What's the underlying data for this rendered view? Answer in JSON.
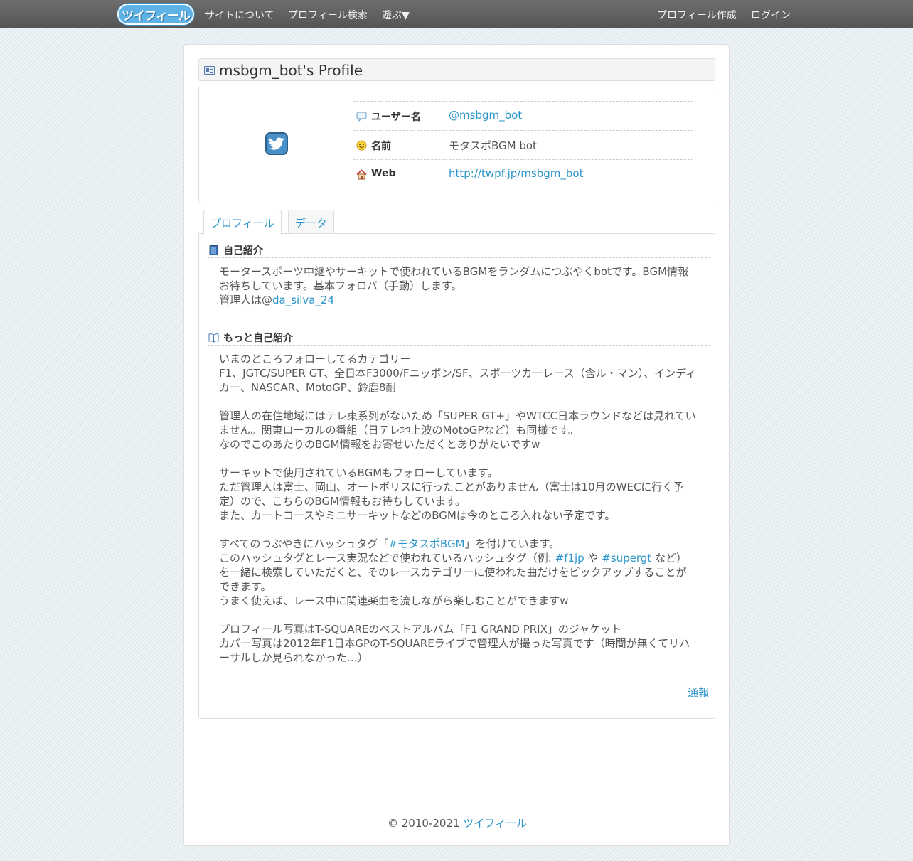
{
  "navbar": {
    "logo_text": "ツイフィール",
    "about": "サイトについて",
    "search": "プロフィール検索",
    "play": "遊ぶ▼",
    "create": "プロフィール作成",
    "login": "ログイン"
  },
  "profile": {
    "title": "msbgm_bot's Profile",
    "avatar_icon": "twitter-bird-icon",
    "rows": [
      {
        "label": "ユーザー名",
        "value": "@msbgm_bot",
        "icon": "speech-bubble-icon",
        "is_link": true
      },
      {
        "label": "名前",
        "value": "モタスポBGM bot",
        "icon": "smiley-icon",
        "is_link": false
      },
      {
        "label": "Web",
        "value": "http://twpf.jp/msbgm_bot",
        "icon": "house-icon",
        "is_link": true
      }
    ]
  },
  "tabs": [
    {
      "label": "プロフィール",
      "active": true
    },
    {
      "label": "データ",
      "active": false
    }
  ],
  "intro": {
    "title": "自己紹介",
    "text_1": "モータースポーツ中継やサーキットで使われているBGMをランダムにつぶやくbotです。BGM情報お待ちしています。基本フォロバ（手動）します。",
    "text_2_prefix": "管理人は@",
    "text_2_link": "da_silva_24"
  },
  "more_intro": {
    "title": "もっと自己紹介",
    "para_1": "いまのところフォローしてるカテゴリー\nF1、JGTC/SUPER GT、全日本F3000/Fニッポン/SF、スポーツカーレース（含ル・マン）、インディカー、NASCAR、MotoGP、鈴鹿8耐",
    "para_2": "管理人の在住地域にはテレ東系列がないため「SUPER GT+」やWTCC日本ラウンドなどは見れていません。関東ローカルの番組（日テレ地上波のMotoGPなど）も同様です。\nなのでこのあたりのBGM情報をお寄せいただくとありがたいですw",
    "para_3": "サーキットで使用されているBGMもフォローしています。\nただ管理人は富士、岡山、オートポリスに行ったことがありません（富士は10月のWECに行く予定）ので、こちらのBGM情報もお待ちしています。\nまた、カートコースやミニサーキットなどのBGMは今のところ入れない予定です。",
    "para_4_a": "すべてのつぶやきにハッシュタグ「",
    "para_4_tag": "#モタスポBGM",
    "para_4_b": "」を付けています。\nこのハッシュタグとレース実況などで使われているハッシュタグ（例: ",
    "para_4_tag2": "#f1jp",
    "para_4_c": " や ",
    "para_4_tag3": "#supergt",
    "para_4_d": " など）を一緒に検索していただくと、そのレースカテゴリーに使われた曲だけをピックアップすることができます。\nうまく使えば、レース中に関連楽曲を流しながら楽しむことができますw",
    "para_5": "プロフィール写真はT-SQUAREのベストアルバム「F1 GRAND PRIX」のジャケット\nカバー写真は2012年F1日本GPのT-SQUAREライブで管理人が撮った写真です（時間が無くてリハーサルしか見られなかった…）"
  },
  "report": "通報",
  "footer": {
    "copyright": "© 2010-2021 ",
    "site_name": "ツイフィール"
  }
}
